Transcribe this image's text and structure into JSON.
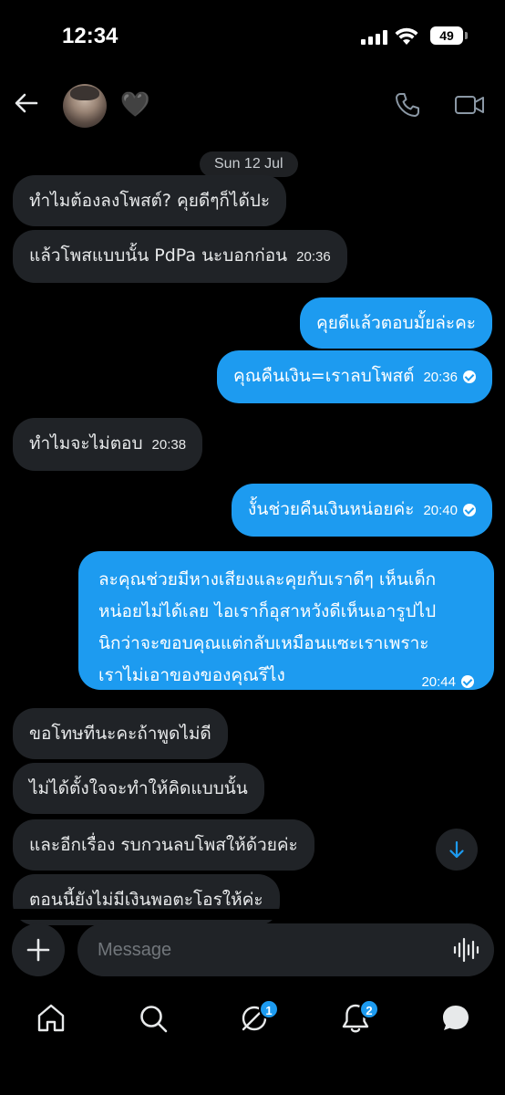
{
  "status_bar": {
    "time": "12:34",
    "battery": "49"
  },
  "header": {
    "contact_name": "🖤",
    "avatar_icon": "avatar-photo",
    "call_icon": "phone-icon",
    "video_icon": "video-icon"
  },
  "date_separator": "Sun 12 Jul",
  "messages": [
    {
      "dir": "in",
      "text": "ทำไมต้องลงโพสต์? คุยดีๆก็ได้ปะ",
      "time": ""
    },
    {
      "dir": "in",
      "text": "แล้วโพสแบบนั้น PdPa นะบอกก่อน",
      "time": "20:36"
    },
    {
      "dir": "out",
      "text": "คุยดีแล้วตอบมั้ยล่ะคะ",
      "time": ""
    },
    {
      "dir": "out",
      "text": "คุณคืนเงิน=เราลบโพสต์",
      "time": "20:36"
    },
    {
      "dir": "in",
      "text": "ทำไมจะไม่ตอบ",
      "time": "20:38"
    },
    {
      "dir": "out",
      "text": "งั้นช่วยคืนเงินหน่อยค่ะ",
      "time": "20:40"
    },
    {
      "dir": "out",
      "lines": [
        "ละคุณช่วยมีหางเสียงและคุยกับเราดีๆ เห็นเด็ก",
        "หน่อยไม่ได้เลย ไอเราก็อุสาหวังดีเห็นเอารูปไป",
        "นิกว่าจะขอบคุณแต่กลับเหมือนแซะเราเพราะ",
        "เราไม่เอาของของคุณรึไง"
      ],
      "time": "20:44"
    },
    {
      "dir": "in",
      "text": "ขอโทษทีนะคะถ้าพูดไม่ดี",
      "time": ""
    },
    {
      "dir": "in",
      "text": "ไม่ได้ตั้งใจจะทำให้คิดแบบนั้น",
      "time": ""
    },
    {
      "dir": "in",
      "text": "และอีกเรื่อง รบกวนลบโพสให้ด้วยค่ะ",
      "time": ""
    },
    {
      "dir": "in",
      "text": "ตอนนี้ยังไม่มีเงินพอตะโอรให้ค่ะ",
      "time": ""
    }
  ],
  "composer": {
    "placeholder": "Message"
  },
  "tabs": [
    {
      "name": "home",
      "icon": "home-icon",
      "badge": ""
    },
    {
      "name": "search",
      "icon": "search-icon",
      "badge": ""
    },
    {
      "name": "grok",
      "icon": "grok-icon",
      "badge": "1"
    },
    {
      "name": "notifications",
      "icon": "bell-icon",
      "badge": "2"
    },
    {
      "name": "messages",
      "icon": "chat-bubble-icon",
      "badge": ""
    }
  ],
  "colors": {
    "accent": "#1d9bf0",
    "incoming_bubble": "#202327",
    "background": "#000000"
  }
}
